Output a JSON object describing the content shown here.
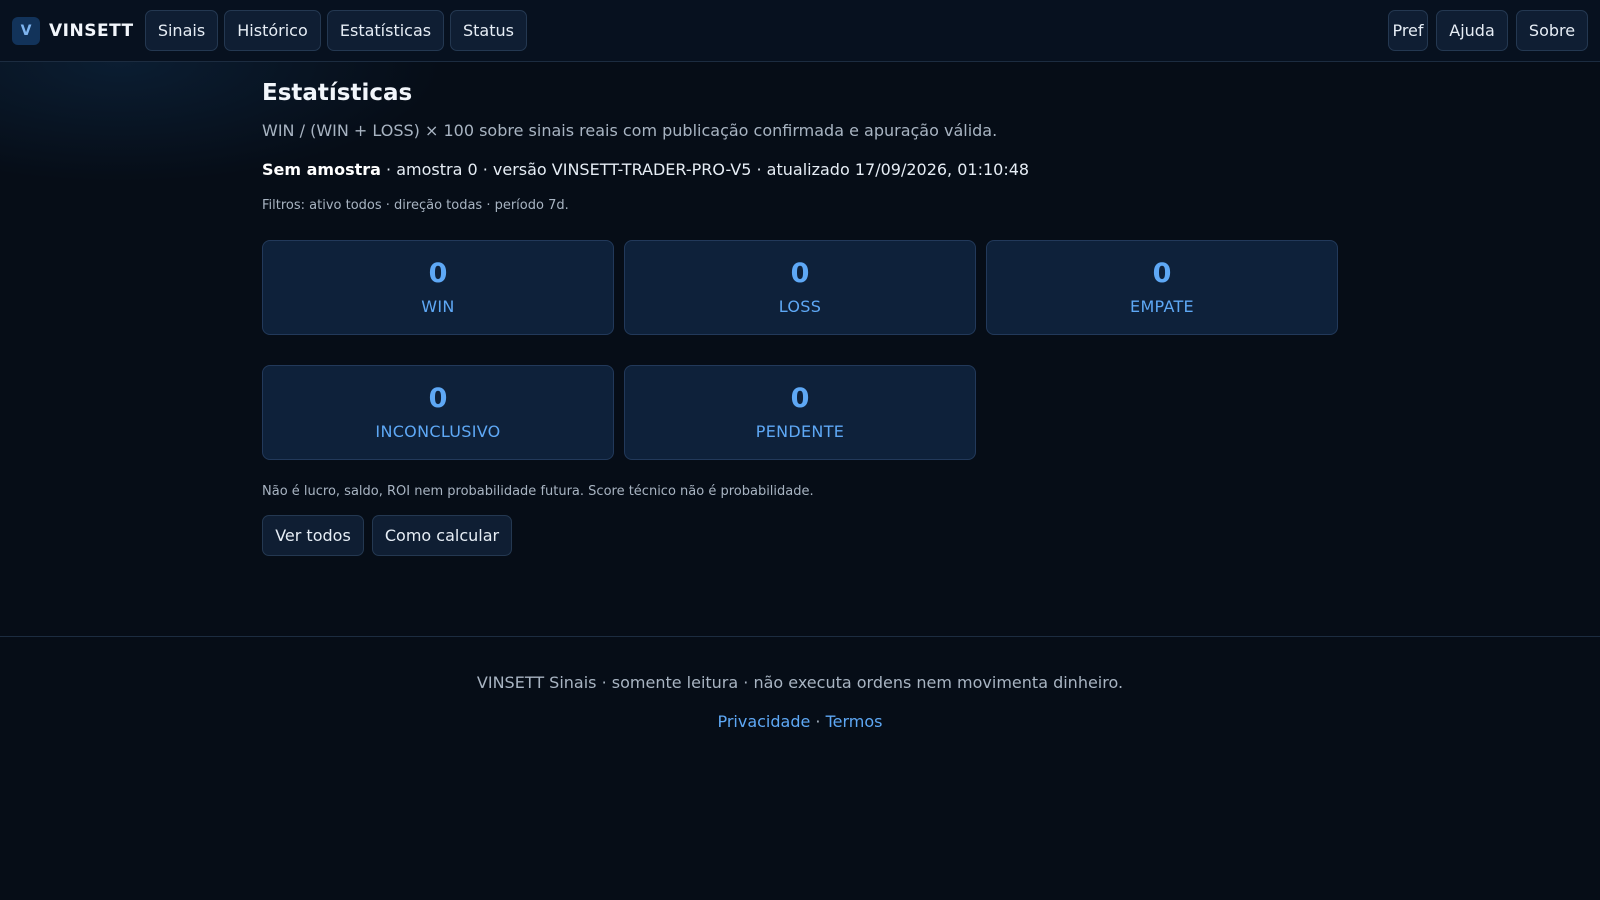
{
  "brand": {
    "logo_letter": "V",
    "name": "VINSETT"
  },
  "nav": {
    "left": [
      "Sinais",
      "Histórico",
      "Estatísticas",
      "Status"
    ],
    "right": [
      "Pref",
      "Ajuda",
      "Sobre"
    ]
  },
  "page": {
    "title": "Estatísticas",
    "subtitle": "WIN / (WIN + LOSS) × 100 sobre sinais reais com publicação confirmada e apuração válida.",
    "meta_status": "Sem amostra",
    "meta_rest": " · amostra 0 · versão VINSETT-TRADER-PRO-V5 · atualizado 17/09/2026, 01:10:48",
    "filters": "Filtros: ativo todos · direção todas · período 7d."
  },
  "stats": [
    {
      "value": "0",
      "label": "WIN"
    },
    {
      "value": "0",
      "label": "LOSS"
    },
    {
      "value": "0",
      "label": "EMPATE"
    },
    {
      "value": "0",
      "label": "INCONCLUSIVO"
    },
    {
      "value": "0",
      "label": "PENDENTE"
    }
  ],
  "disclaimer": "Não é lucro, saldo, ROI nem probabilidade futura. Score técnico não é probabilidade.",
  "actions": {
    "view_all": "Ver todos",
    "how_to": "Como calcular"
  },
  "footer": {
    "text": "VINSETT Sinais · somente leitura · não executa ordens nem movimenta dinheiro.",
    "privacy": "Privacidade",
    "separator": " · ",
    "terms": "Termos"
  },
  "colors": {
    "accent": "#5ea8f5",
    "background": "#060d17",
    "card": "#0e213a"
  }
}
